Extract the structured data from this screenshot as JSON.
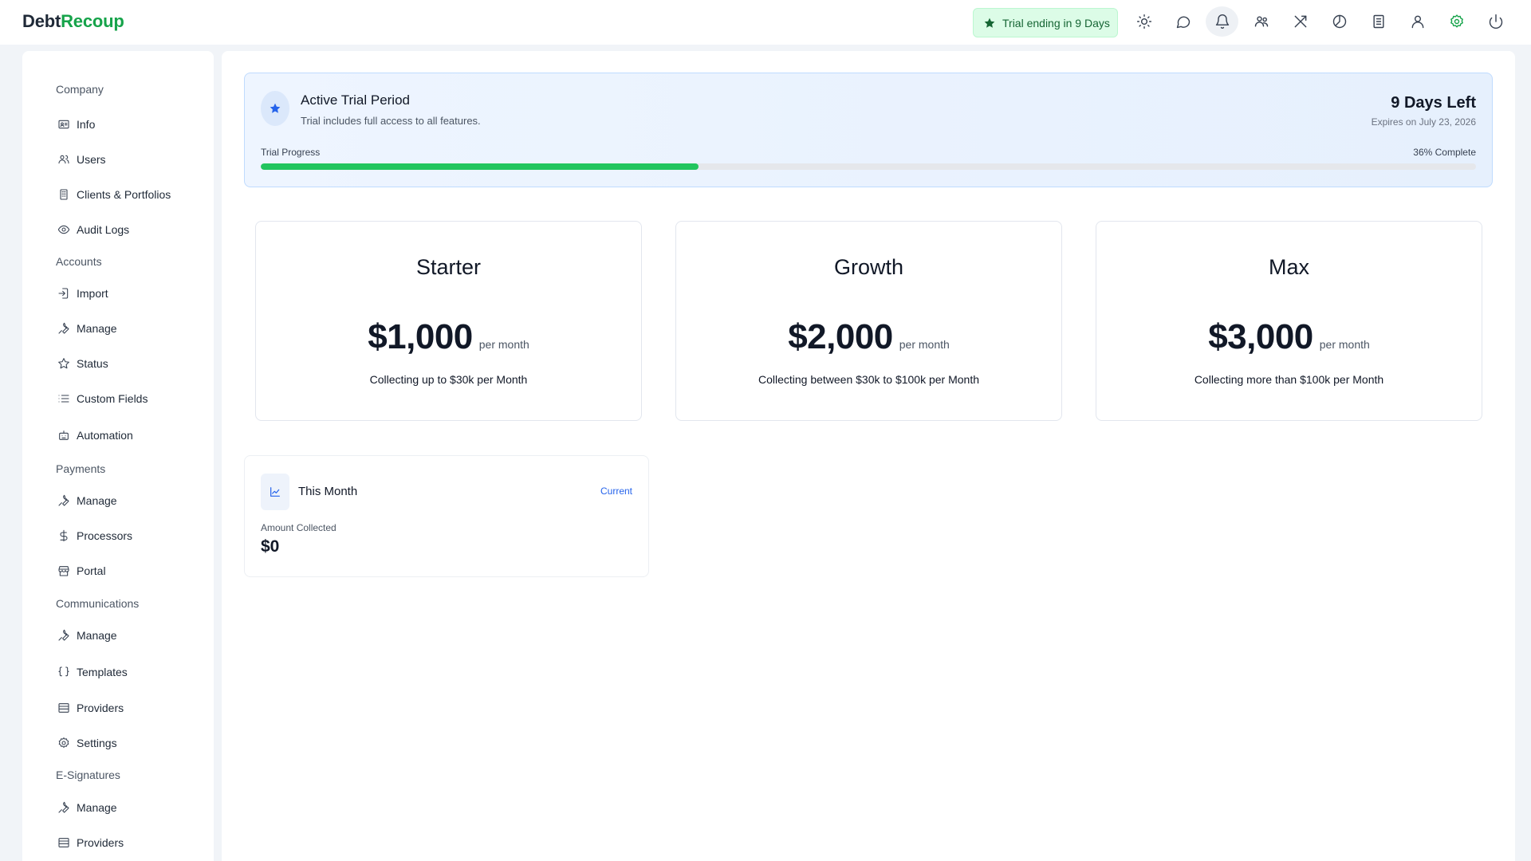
{
  "app": {
    "logo_part1": "Debt",
    "logo_part2": "Recoup",
    "brand_color": "#16a34a"
  },
  "header": {
    "trial_badge": "Trial ending in 9 Days",
    "icons": [
      "sun-icon",
      "chat-icon",
      "bell-icon",
      "team-icon",
      "tools-icon",
      "clock-icon",
      "ledger-icon",
      "user-icon",
      "settings-icon",
      "power-icon"
    ]
  },
  "sidebar": {
    "sections": [
      {
        "title": "Company",
        "items": [
          {
            "label": "Info",
            "icon": "id-card-icon"
          },
          {
            "label": "Users",
            "icon": "users-icon"
          },
          {
            "label": "Clients & Portfolios",
            "icon": "building-icon"
          },
          {
            "label": "Audit Logs",
            "icon": "eye-icon"
          }
        ]
      },
      {
        "title": "Accounts",
        "items": [
          {
            "label": "Import",
            "icon": "import-icon"
          },
          {
            "label": "Manage",
            "icon": "wrench-icon"
          },
          {
            "label": "Status",
            "icon": "star-icon"
          },
          {
            "label": "Custom Fields",
            "icon": "list-icon"
          },
          {
            "label": "Automation",
            "icon": "robot-icon"
          }
        ]
      },
      {
        "title": "Payments",
        "items": [
          {
            "label": "Manage",
            "icon": "wrench-icon"
          },
          {
            "label": "Processors",
            "icon": "dollar-icon"
          },
          {
            "label": "Portal",
            "icon": "store-icon"
          }
        ]
      },
      {
        "title": "Communications",
        "items": [
          {
            "label": "Manage",
            "icon": "wrench-icon"
          },
          {
            "label": "Templates",
            "icon": "braces-icon"
          },
          {
            "label": "Providers",
            "icon": "server-icon"
          },
          {
            "label": "Settings",
            "icon": "gear-icon"
          }
        ]
      },
      {
        "title": "E-Signatures",
        "items": [
          {
            "label": "Manage",
            "icon": "wrench-icon"
          },
          {
            "label": "Providers",
            "icon": "server-icon"
          }
        ]
      }
    ]
  },
  "trial": {
    "title": "Active Trial Period",
    "subtitle": "Trial includes full access to all features.",
    "days_left": "9 Days Left",
    "expires": "Expires on July 23, 2026",
    "progress_label": "Trial Progress",
    "progress_text": "36% Complete",
    "progress_fraction": 0.36,
    "progress_color": "#22c55e"
  },
  "plans": [
    {
      "name": "Starter",
      "price": "$1,000",
      "per": "per month",
      "desc": "Collecting up to $30k per Month"
    },
    {
      "name": "Growth",
      "price": "$2,000",
      "per": "per month",
      "desc": "Collecting between $30k to $100k per Month"
    },
    {
      "name": "Max",
      "price": "$3,000",
      "per": "per month",
      "desc": "Collecting more than $100k per Month"
    }
  ],
  "this_month": {
    "title": "This Month",
    "current_label": "Current",
    "amount_label": "Amount Collected",
    "amount_value": "$0"
  }
}
